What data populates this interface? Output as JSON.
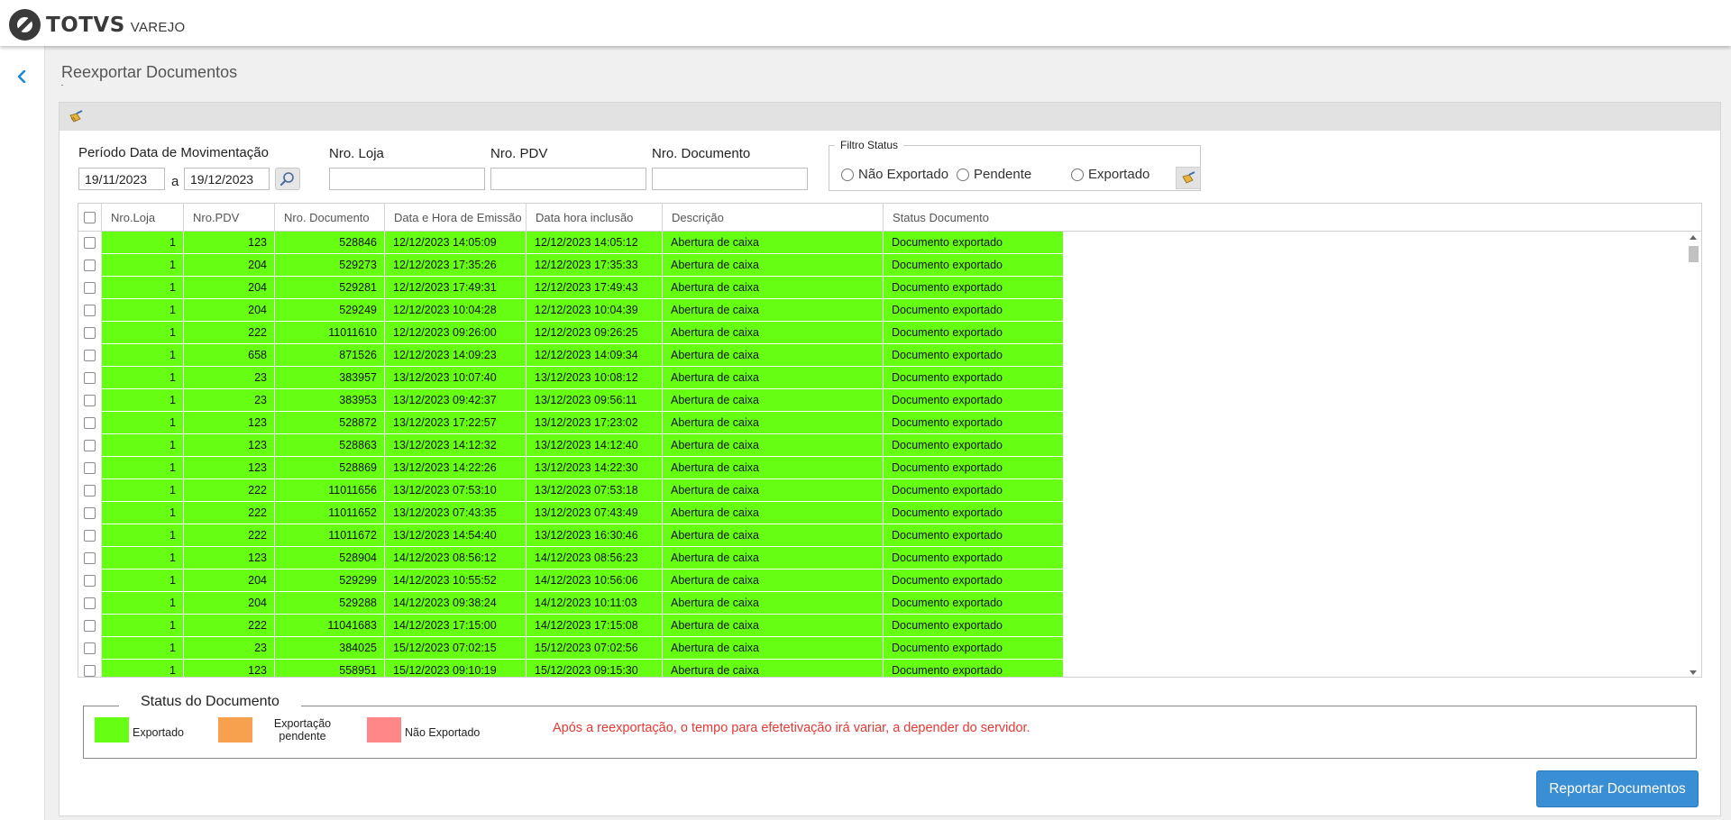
{
  "header": {
    "brand": "TOTVS",
    "product": "VAREJO"
  },
  "page": {
    "title": "Reexportar Documentos"
  },
  "filters": {
    "period_label": "Período Data de Movimentação",
    "date_from": "19/11/2023",
    "date_sep": "a",
    "date_to": "19/12/2023",
    "loja_label": "Nro. Loja",
    "pdv_label": "Nro. PDV",
    "documento_label": "Nro. Documento",
    "status_filter": {
      "legend": "Filtro Status",
      "options": [
        "Não Exportado",
        "Pendente",
        "Exportado"
      ]
    }
  },
  "table": {
    "columns": [
      "Nro.Loja",
      "Nro.PDV",
      "Nro. Documento",
      "Data e Hora de Emissão",
      "Data hora inclusão",
      "Descrição",
      "Status Documento"
    ],
    "rows": [
      [
        "1",
        "123",
        "528846",
        "12/12/2023 14:05:09",
        "12/12/2023 14:05:12",
        "Abertura de caixa",
        "Documento exportado"
      ],
      [
        "1",
        "204",
        "529273",
        "12/12/2023 17:35:26",
        "12/12/2023 17:35:33",
        "Abertura de caixa",
        "Documento exportado"
      ],
      [
        "1",
        "204",
        "529281",
        "12/12/2023 17:49:31",
        "12/12/2023 17:49:43",
        "Abertura de caixa",
        "Documento exportado"
      ],
      [
        "1",
        "204",
        "529249",
        "12/12/2023 10:04:28",
        "12/12/2023 10:04:39",
        "Abertura de caixa",
        "Documento exportado"
      ],
      [
        "1",
        "222",
        "11011610",
        "12/12/2023 09:26:00",
        "12/12/2023 09:26:25",
        "Abertura de caixa",
        "Documento exportado"
      ],
      [
        "1",
        "658",
        "871526",
        "12/12/2023 14:09:23",
        "12/12/2023 14:09:34",
        "Abertura de caixa",
        "Documento exportado"
      ],
      [
        "1",
        "23",
        "383957",
        "13/12/2023 10:07:40",
        "13/12/2023 10:08:12",
        "Abertura de caixa",
        "Documento exportado"
      ],
      [
        "1",
        "23",
        "383953",
        "13/12/2023 09:42:37",
        "13/12/2023 09:56:11",
        "Abertura de caixa",
        "Documento exportado"
      ],
      [
        "1",
        "123",
        "528872",
        "13/12/2023 17:22:57",
        "13/12/2023 17:23:02",
        "Abertura de caixa",
        "Documento exportado"
      ],
      [
        "1",
        "123",
        "528863",
        "13/12/2023 14:12:32",
        "13/12/2023 14:12:40",
        "Abertura de caixa",
        "Documento exportado"
      ],
      [
        "1",
        "123",
        "528869",
        "13/12/2023 14:22:26",
        "13/12/2023 14:22:30",
        "Abertura de caixa",
        "Documento exportado"
      ],
      [
        "1",
        "222",
        "11011656",
        "13/12/2023 07:53:10",
        "13/12/2023 07:53:18",
        "Abertura de caixa",
        "Documento exportado"
      ],
      [
        "1",
        "222",
        "11011652",
        "13/12/2023 07:43:35",
        "13/12/2023 07:43:49",
        "Abertura de caixa",
        "Documento exportado"
      ],
      [
        "1",
        "222",
        "11011672",
        "13/12/2023 14:54:40",
        "13/12/2023 16:30:46",
        "Abertura de caixa",
        "Documento exportado"
      ],
      [
        "1",
        "123",
        "528904",
        "14/12/2023 08:56:12",
        "14/12/2023 08:56:23",
        "Abertura de caixa",
        "Documento exportado"
      ],
      [
        "1",
        "204",
        "529299",
        "14/12/2023 10:55:52",
        "14/12/2023 10:56:06",
        "Abertura de caixa",
        "Documento exportado"
      ],
      [
        "1",
        "204",
        "529288",
        "14/12/2023 09:38:24",
        "14/12/2023 10:11:03",
        "Abertura de caixa",
        "Documento exportado"
      ],
      [
        "1",
        "222",
        "11041683",
        "14/12/2023 17:15:00",
        "14/12/2023 17:15:08",
        "Abertura de caixa",
        "Documento exportado"
      ],
      [
        "1",
        "23",
        "384025",
        "15/12/2023 07:02:15",
        "15/12/2023 07:02:56",
        "Abertura de caixa",
        "Documento exportado"
      ],
      [
        "1",
        "123",
        "558951",
        "15/12/2023 09:10:19",
        "15/12/2023 09:15:30",
        "Abertura de caixa",
        "Documento exportado"
      ]
    ]
  },
  "legend": {
    "title": "Status do Documento",
    "items": [
      {
        "label": "Exportado",
        "color": "#66ff14"
      },
      {
        "label": "Exportação pendente",
        "color": "#f7a14e"
      },
      {
        "label": "Não Exportado",
        "color": "#ff8787"
      }
    ],
    "note": "Após a reexportação, o tempo para efetetivação irá variar, a depender do servidor."
  },
  "actions": {
    "reexport_label": "Reportar Documentos"
  },
  "colors": {
    "exported_row": "#66ff14",
    "primary_button": "#3a8ed4",
    "note_text": "#e53935"
  }
}
